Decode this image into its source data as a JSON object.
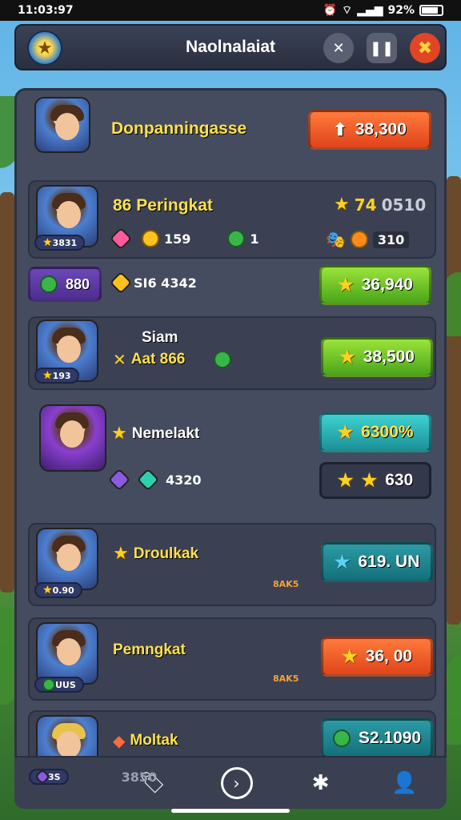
{
  "status": {
    "time": "11:03:97",
    "battery": "92%"
  },
  "header": {
    "title": "Naolnalaiat"
  },
  "rows": [
    {
      "name": "Donpanningasse",
      "button": "38,300"
    },
    {
      "name": "86  Peringkat",
      "avatar_tag": "3831",
      "stat1": "159",
      "stat2": "1",
      "rank_value": "74",
      "rank_extra": "0510",
      "extra": "310"
    },
    {
      "badge": "880",
      "label": "SI6 4342",
      "button": "36,940"
    },
    {
      "name_line1": "Siam",
      "name_line2": "Aat 866",
      "avatar_tag": "193",
      "button": "38,500"
    },
    {
      "name": "Nemelakt",
      "stat": "4320",
      "button_top": "6300%",
      "button_bottom": "630"
    },
    {
      "name": "Droulkak",
      "avatar_tag": "0.90",
      "mini": "8AK5",
      "button": "619. UN"
    },
    {
      "name": "Pemngkat",
      "avatar_tag": "UUS",
      "mini": "8AK5",
      "button": "36, 00"
    },
    {
      "name": "Moltak",
      "avatar_tag": "3S",
      "stat": "3850",
      "button": "S2.1090"
    }
  ],
  "colors": {
    "accent_orange": "#e0441b",
    "accent_green": "#4aa51a",
    "accent_teal": "#1a9298",
    "panel": "#454c5f"
  },
  "tabbar": {
    "icons": [
      "tag-icon",
      "play-circle-icon",
      "puzzle-icon",
      "profile-icon"
    ]
  }
}
